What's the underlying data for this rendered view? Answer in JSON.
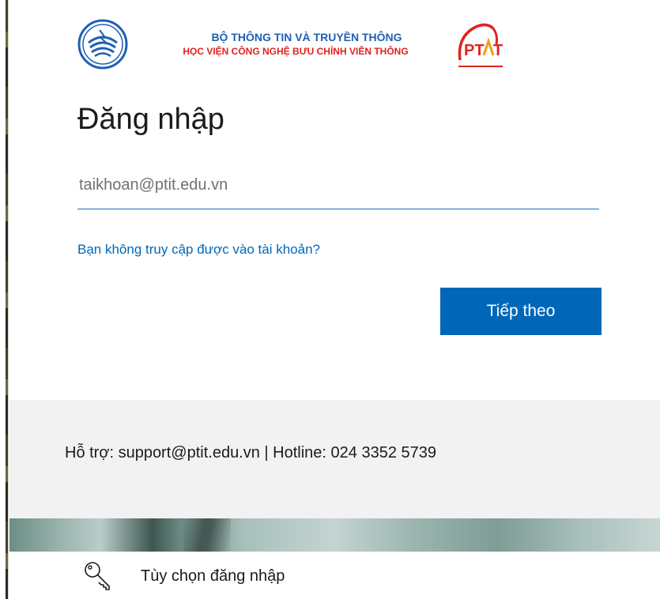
{
  "header": {
    "org_line1": "BỘ THÔNG TIN VÀ TRUYỀN THÔNG",
    "org_line2": "HỌC VIỆN CÔNG NGHỆ BƯU CHÍNH VIỄN THÔNG",
    "logo_right_text": "PTIT",
    "logo_left_icon": "ministry-emblem-icon"
  },
  "signin": {
    "title": "Đăng nhập",
    "email_placeholder": "taikhoan@ptit.edu.vn",
    "email_value": "",
    "cant_access_link": "Bạn không truy cập được vào tài khoản?",
    "next_button": "Tiếp theo"
  },
  "support": {
    "text": "Hỗ trợ: support@ptit.edu.vn | Hotline: 024 3352 5739"
  },
  "options": {
    "label": "Tùy chọn đăng nhập",
    "icon": "key-icon"
  },
  "colors": {
    "accent": "#0067b8",
    "org_blue": "#1f5fb4",
    "org_red": "#e0231e",
    "support_bg": "#f2f2f2"
  }
}
